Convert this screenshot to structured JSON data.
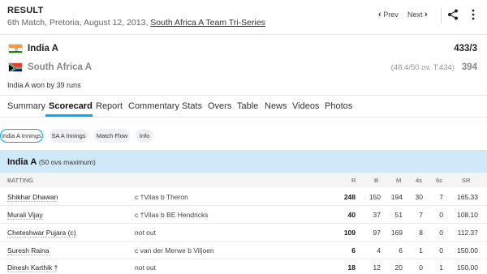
{
  "header": {
    "result_label": "RESULT",
    "match_prefix": "6th Match, Pretoria, August 12, 2013, ",
    "series_link": "South Africa A Team Tri-Series",
    "prev_label": "Prev",
    "next_label": "Next",
    "prev_icon": "chevron-left-icon",
    "next_icon": "chevron-right-icon",
    "share_icon": "share-icon",
    "more_icon": "more-vertical-icon"
  },
  "teams": [
    {
      "name": "India A",
      "score": "433/3",
      "overs": "",
      "flag": "india-flag-icon"
    },
    {
      "name": "South Africa A",
      "score": "394",
      "overs": "(48.4/50 ov, T:434)",
      "flag": "south-africa-flag-icon"
    }
  ],
  "result_text": "India A won by 39 runs",
  "tabs": [
    "Summary",
    "Scorecard",
    "Report",
    "Commentary",
    "Stats",
    "Overs",
    "Table",
    "News",
    "Videos",
    "Photos"
  ],
  "active_tab": "Scorecard",
  "pills": [
    "India A Innings",
    "SA A Innings",
    "Match Flow",
    "Info"
  ],
  "active_pill": "India A Innings",
  "innings": {
    "team": "India A",
    "sub": "(50 ovs maximum)"
  },
  "batting": {
    "headers": [
      "BATTING",
      "R",
      "B",
      "M",
      "4s",
      "6s",
      "SR"
    ],
    "rows": [
      {
        "name": "Shikhar Dhawan",
        "dismissal": "c †Vilas b Theron",
        "r": "248",
        "b": "150",
        "m": "194",
        "fours": "30",
        "sixes": "7",
        "sr": "165.33"
      },
      {
        "name": "Murali Vijay",
        "dismissal": "c †Vilas b BE Hendricks",
        "r": "40",
        "b": "37",
        "m": "51",
        "fours": "7",
        "sixes": "0",
        "sr": "108.10"
      },
      {
        "name": "Cheteshwar Pujara (c)",
        "dismissal": "not out",
        "r": "109",
        "b": "97",
        "m": "169",
        "fours": "8",
        "sixes": "0",
        "sr": "112.37"
      },
      {
        "name": "Suresh Raina",
        "dismissal": "c van der Merwe b Viljoen",
        "r": "6",
        "b": "4",
        "m": "6",
        "fours": "1",
        "sixes": "0",
        "sr": "150.00"
      },
      {
        "name": "Dinesh Karthik †",
        "dismissal": "not out",
        "r": "18",
        "b": "12",
        "m": "20",
        "fours": "0",
        "sixes": "1",
        "sr": "150.00"
      }
    ]
  },
  "colors": {
    "accent": "#03a9f4",
    "innings_bar": "#cfe9f9"
  }
}
